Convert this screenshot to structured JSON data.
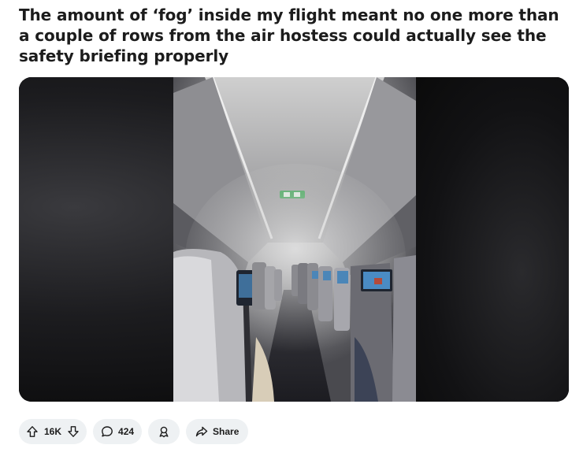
{
  "post": {
    "title": "The amount of ‘fog’ inside my flight meant no one more than a couple of rows from the air hostess could actually see the safety briefing properly"
  },
  "media": {
    "alt_icon": "video-frame"
  },
  "actions": {
    "vote_count": "16K",
    "comment_count": "424",
    "share_label": "Share"
  },
  "icons": {
    "upvote": "arrow-up-icon",
    "downvote": "arrow-down-icon",
    "comment": "comment-bubble-icon",
    "award": "award-icon",
    "share": "share-arrow-icon"
  },
  "colors": {
    "pill_bg": "#eef1f3",
    "title": "#1c1c1c",
    "exit_sign": "#2fa34a"
  }
}
